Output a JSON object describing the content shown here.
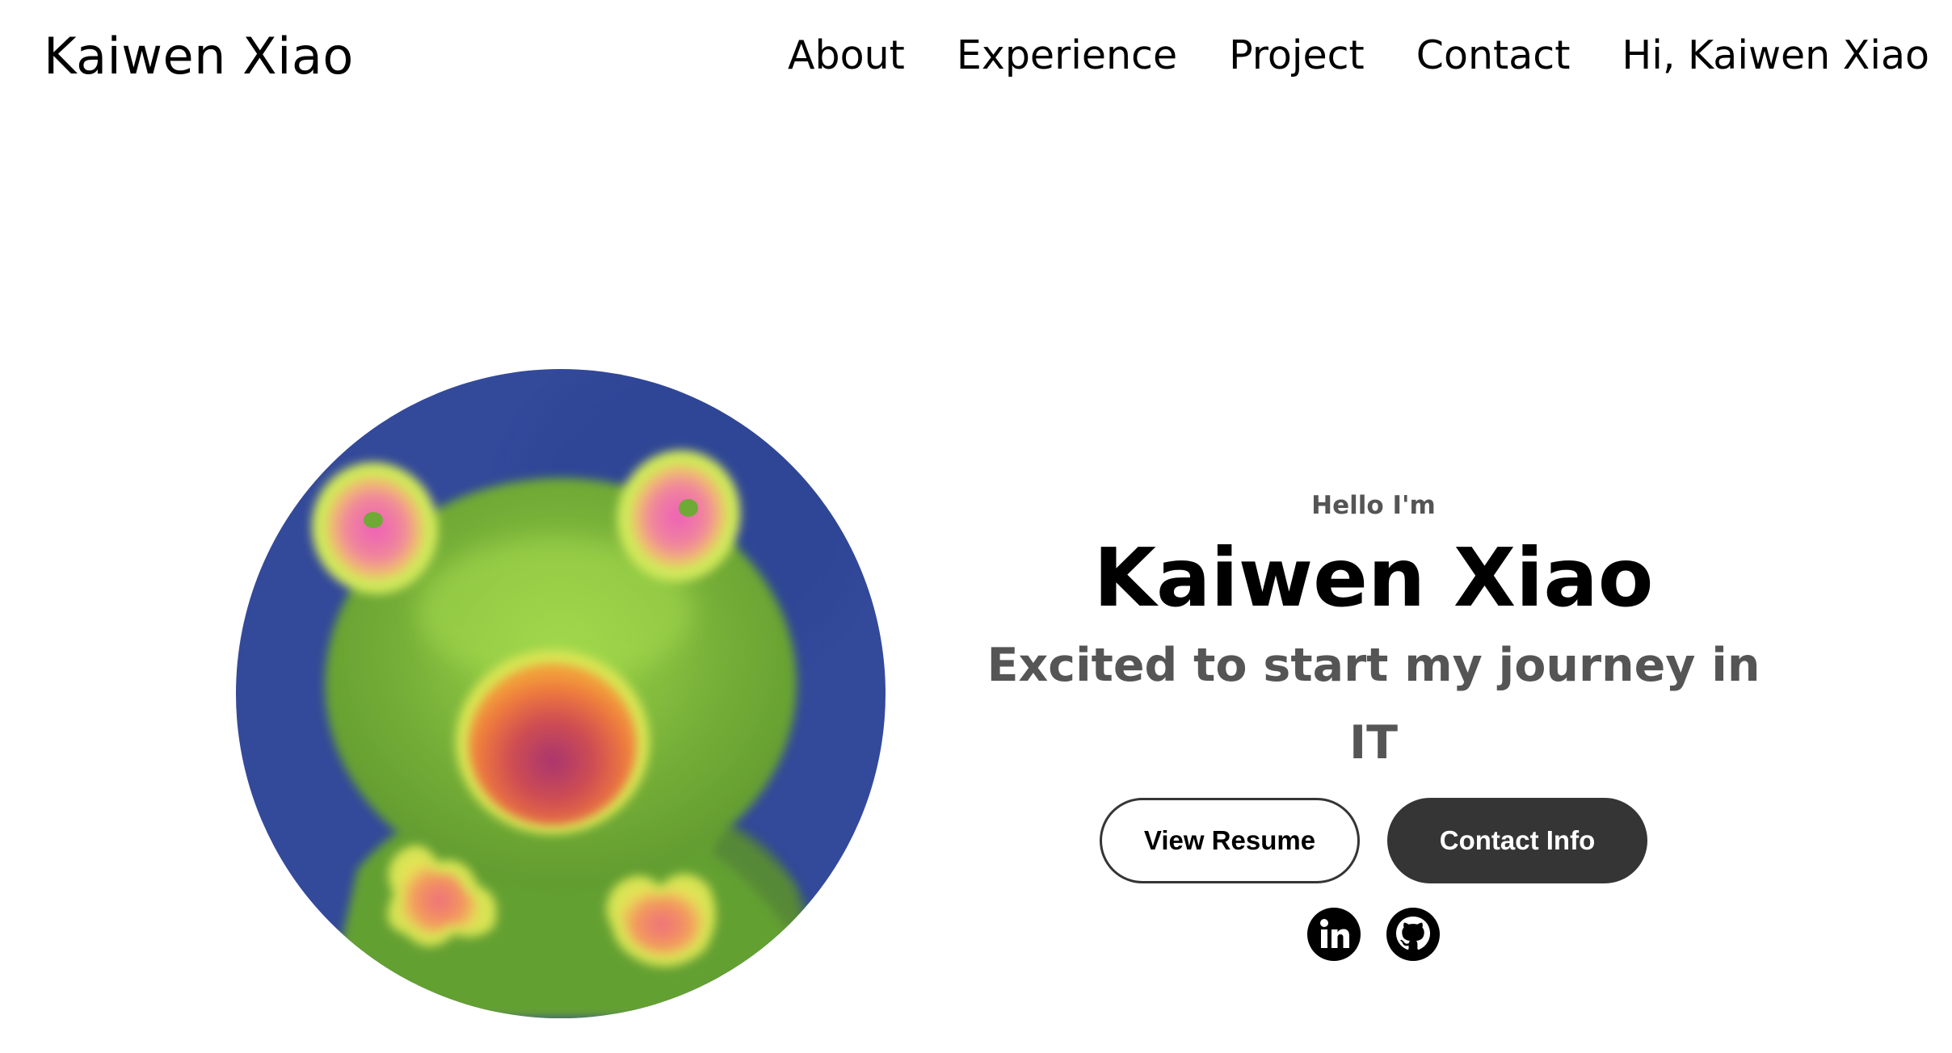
{
  "nav": {
    "logo": "Kaiwen Xiao",
    "links": [
      {
        "label": "About"
      },
      {
        "label": "Experience"
      },
      {
        "label": "Project"
      },
      {
        "label": "Contact"
      },
      {
        "label": "Hi, Kaiwen Xiao"
      }
    ]
  },
  "hero": {
    "greeting": "Hello I'm",
    "name": "Kaiwen Xiao",
    "tagline": "Excited to start my journey in IT",
    "buttons": {
      "resume": "View Resume",
      "contact": "Contact Info"
    },
    "socials": [
      {
        "icon": "linkedin-icon"
      },
      {
        "icon": "github-icon"
      }
    ]
  },
  "colors": {
    "avatar_bg": "#33499a",
    "frog_green": "#6eaa35",
    "button_dark": "#353535",
    "muted_text": "#555555"
  }
}
